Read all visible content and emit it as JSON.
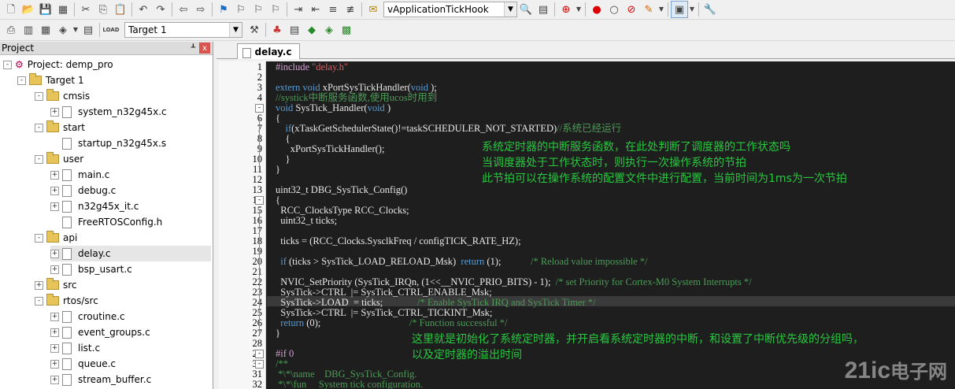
{
  "toolbar1": {
    "function_combo_value": "vApplicationTickHook"
  },
  "toolbar2": {
    "target_combo_value": "Target 1",
    "load_label": "LOAD"
  },
  "project_pane": {
    "title": "Project",
    "pin": "Ͱ",
    "close": "x",
    "tree": [
      {
        "label": "Project: demp_pro",
        "kind": "project",
        "indent": 0,
        "exp": "-"
      },
      {
        "label": "Target 1",
        "kind": "target",
        "indent": 1,
        "exp": "-"
      },
      {
        "label": "cmsis",
        "kind": "folder",
        "indent": 2,
        "exp": "-"
      },
      {
        "label": "system_n32g45x.c",
        "kind": "file",
        "indent": 3,
        "exp": "+"
      },
      {
        "label": "start",
        "kind": "folder",
        "indent": 2,
        "exp": "-"
      },
      {
        "label": "startup_n32g45x.s",
        "kind": "file",
        "indent": 3,
        "exp": ""
      },
      {
        "label": "user",
        "kind": "folder",
        "indent": 2,
        "exp": "-"
      },
      {
        "label": "main.c",
        "kind": "file",
        "indent": 3,
        "exp": "+"
      },
      {
        "label": "debug.c",
        "kind": "file",
        "indent": 3,
        "exp": "+"
      },
      {
        "label": "n32g45x_it.c",
        "kind": "file",
        "indent": 3,
        "exp": "+"
      },
      {
        "label": "FreeRTOSConfig.h",
        "kind": "file",
        "indent": 3,
        "exp": ""
      },
      {
        "label": "api",
        "kind": "folder",
        "indent": 2,
        "exp": "-"
      },
      {
        "label": "delay.c",
        "kind": "file",
        "indent": 3,
        "exp": "+",
        "selected": true
      },
      {
        "label": "bsp_usart.c",
        "kind": "file",
        "indent": 3,
        "exp": "+"
      },
      {
        "label": "src",
        "kind": "folder",
        "indent": 2,
        "exp": "+"
      },
      {
        "label": "rtos/src",
        "kind": "folder",
        "indent": 2,
        "exp": "-"
      },
      {
        "label": "croutine.c",
        "kind": "file",
        "indent": 3,
        "exp": "+"
      },
      {
        "label": "event_groups.c",
        "kind": "file",
        "indent": 3,
        "exp": "+"
      },
      {
        "label": "list.c",
        "kind": "file",
        "indent": 3,
        "exp": "+"
      },
      {
        "label": "queue.c",
        "kind": "file",
        "indent": 3,
        "exp": "+"
      },
      {
        "label": "stream_buffer.c",
        "kind": "file",
        "indent": 3,
        "exp": "+"
      }
    ]
  },
  "editor": {
    "tab_label": "delay.c",
    "line_numbers": [
      "1",
      "2",
      "3",
      "4",
      "5",
      "6",
      "7",
      "8",
      "9",
      "10",
      "11",
      "12",
      "13",
      "14",
      "15",
      "16",
      "17",
      "18",
      "19",
      "20",
      "21",
      "22",
      "23",
      "24",
      "25",
      "26",
      "27",
      "28",
      "29",
      "30",
      "31",
      "32"
    ],
    "lines": [
      [
        [
          "pp2",
          "#include "
        ],
        [
          "str",
          "\"delay.h\""
        ]
      ],
      [],
      [
        [
          "kw",
          "extern void"
        ],
        [
          "",
          "xPortSysTickHandler("
        ],
        [
          "kw",
          "void"
        ],
        [
          "",
          ");"
        ]
      ],
      [
        [
          "cm",
          "//systick中断服务函数,使用ucos时用到"
        ]
      ],
      [
        [
          "kw",
          "void"
        ],
        [
          "",
          "SysTick_Handler("
        ],
        [
          "kw",
          "void"
        ],
        [
          "",
          ")"
        ]
      ],
      [
        [
          "",
          "{"
        ]
      ],
      [
        [
          "",
          "    "
        ],
        [
          "kw",
          "if"
        ],
        [
          "",
          "(xTaskGetSchedulerState()!=taskSCHEDULER_NOT_STARTED)"
        ],
        [
          "cm",
          "//系统已经运行"
        ]
      ],
      [
        [
          "",
          "    {"
        ]
      ],
      [
        [
          "",
          "      xPortSysTickHandler();"
        ]
      ],
      [
        [
          "",
          "    }"
        ]
      ],
      [
        [
          "",
          "}"
        ]
      ],
      [],
      [
        [
          "",
          "uint32_t DBG_SysTick_Config()"
        ]
      ],
      [
        [
          "",
          "{"
        ]
      ],
      [
        [
          "",
          "  RCC_ClocksType RCC_Clocks;"
        ]
      ],
      [
        [
          "",
          "  uint32_t ticks;"
        ]
      ],
      [],
      [
        [
          "",
          "  ticks = (RCC_Clocks.SysclkFreq / configTICK_RATE_HZ);"
        ]
      ],
      [],
      [
        [
          "",
          "  "
        ],
        [
          "kw",
          "if"
        ],
        [
          "",
          " (ticks > SysTick_LOAD_RELOAD_Msk)  "
        ],
        [
          "kw",
          "return"
        ],
        [
          "",
          " (1);            "
        ],
        [
          "cm",
          "/* Reload value impossible */"
        ]
      ],
      [],
      [
        [
          "",
          "  NVIC_SetPriority (SysTick_IRQn, (1<<__NVIC_PRIO_BITS) - 1);  "
        ],
        [
          "cm",
          "/* set Priority for Cortex-M0 System Interrupts */"
        ]
      ],
      [
        [
          "",
          "  SysTick->CTRL  |= SysTick_CTRL_ENABLE_Msk;"
        ]
      ],
      [
        [
          "",
          "  SysTick->LOAD  = ticks;              "
        ],
        [
          "cm",
          "/* Enable SysTick IRQ and SysTick Timer */"
        ]
      ],
      [
        [
          "",
          "  SysTick->CTRL  |= SysTick_CTRL_TICKINT_Msk;"
        ]
      ],
      [
        [
          "",
          "  "
        ],
        [
          "kw",
          "return"
        ],
        [
          "",
          " (0);                                    "
        ],
        [
          "cm",
          "/* Function successful */"
        ]
      ],
      [
        [
          "",
          "}"
        ]
      ],
      [],
      [
        [
          "pp2",
          "#if 0"
        ]
      ],
      [
        [
          "cm",
          "/**"
        ]
      ],
      [
        [
          "cm",
          " *\\*\\name    DBG_SysTick_Config."
        ]
      ],
      [
        [
          "cm",
          " *\\*\\fun     System tick configuration."
        ]
      ]
    ],
    "annotation1": [
      "系统定时器的中断服务函数，在此处判断了调度器的工作状态吗",
      "当调度器处于工作状态时，则执行一次操作系统的节拍",
      "此节拍可以在操作系统的配置文件中进行配置，当前时间为1ms为一次节拍"
    ],
    "annotation2": [
      "这里就是初始化了系统定时器，并开启看系统定时器的中断，和设置了中断优先级的分组吗，",
      "以及定时器的溢出时间"
    ]
  },
  "watermark": {
    "main": "21ic",
    "sub": "电子网"
  }
}
